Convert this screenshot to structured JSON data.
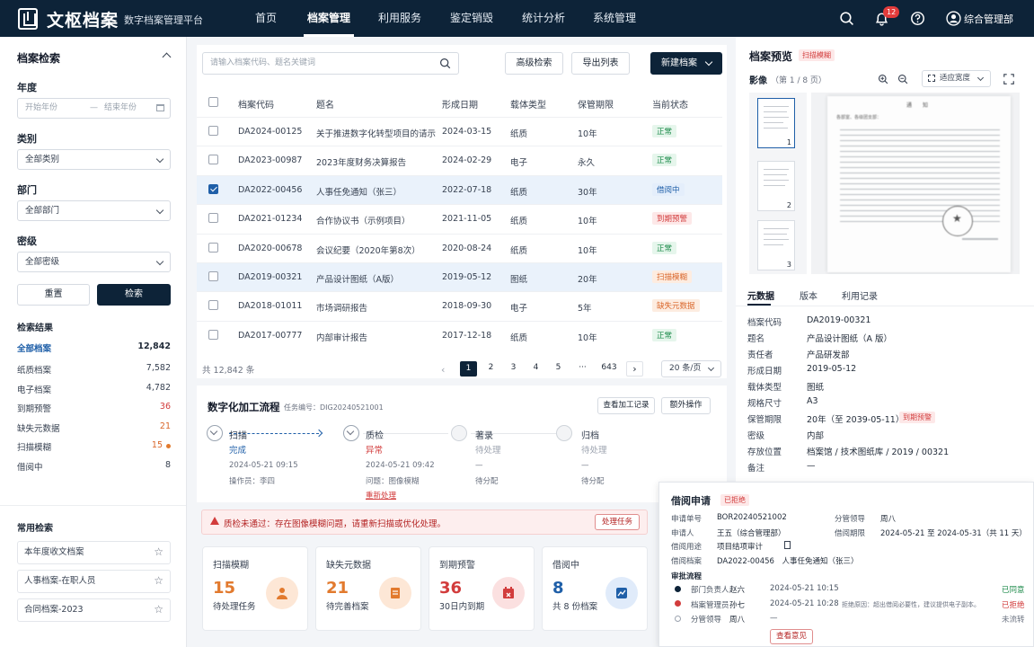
{
  "app": {
    "brand": "文枢档案",
    "subtitle": "数字档案管理平台"
  },
  "nav": [
    "首页",
    "档案管理",
    "利用服务",
    "鉴定销毁",
    "统计分析",
    "系统管理"
  ],
  "header": {
    "notifications": "12",
    "user": "综合管理部"
  },
  "sidebar": {
    "title": "档案检索",
    "year_label": "年度",
    "year_start": "开始年份",
    "year_sep": "—",
    "year_end": "结束年份",
    "category_label": "类别",
    "category_value": "全部类别",
    "dept_label": "部门",
    "dept_value": "全部部门",
    "secret_label": "密级",
    "secret_value": "全部密级",
    "reset": "重置",
    "search": "检索",
    "results_title": "检索结果",
    "results": [
      {
        "label": "全部档案",
        "count": "12,842"
      },
      {
        "label": "纸质档案",
        "count": "7,582"
      },
      {
        "label": "电子档案",
        "count": "4,782"
      },
      {
        "label": "到期预警",
        "count": "36"
      },
      {
        "label": "缺失元数据",
        "count": "21"
      },
      {
        "label": "扫描模糊",
        "count": "15"
      },
      {
        "label": "借阅中",
        "count": "8"
      }
    ],
    "fav_title": "常用检索",
    "favorites": [
      "本年度收文档案",
      "人事档案-在职人员",
      "合同档案-2023"
    ]
  },
  "toolbar": {
    "search_placeholder": "请输入档案代码、题名关键词",
    "advanced": "高级检索",
    "export": "导出列表",
    "new": "新建档案"
  },
  "table": {
    "headers": [
      "档案代码",
      "题名",
      "形成日期",
      "载体类型",
      "保管期限",
      "当前状态"
    ],
    "rows": [
      [
        "DA2024-00125",
        "关于推进数字化转型项目的请示",
        "2024-03-15",
        "纸质",
        "10年",
        "正常"
      ],
      [
        "DA2023-00987",
        "2023年度财务决算报告",
        "2024-02-29",
        "电子",
        "永久",
        "正常"
      ],
      [
        "DA2022-00456",
        "人事任免通知（张三）",
        "2022-07-18",
        "纸质",
        "30年",
        "借阅中"
      ],
      [
        "DA2021-01234",
        "合作协议书（示例项目）",
        "2021-11-05",
        "纸质",
        "10年",
        "到期预警"
      ],
      [
        "DA2020-00678",
        "会议纪要（2020年第8次）",
        "2020-08-24",
        "纸质",
        "10年",
        "正常"
      ],
      [
        "DA2019-00321",
        "产品设计图纸（A版）",
        "2019-05-12",
        "图纸",
        "20年",
        "扫描模糊"
      ],
      [
        "DA2018-01011",
        "市场调研报告",
        "2018-09-30",
        "电子",
        "5年",
        "缺失元数据"
      ],
      [
        "DA2017-00777",
        "内部审计报告",
        "2017-12-18",
        "纸质",
        "10年",
        "正常"
      ]
    ],
    "total": "共 12,842 条",
    "pages": [
      "1",
      "2",
      "3",
      "4",
      "5",
      "···",
      "643"
    ],
    "page_size": "20 条/页"
  },
  "flow": {
    "title": "数字化加工流程",
    "task_no": "任务编号：DIG20240521001",
    "view_log": "查看加工记录",
    "extra": "额外操作",
    "steps": [
      {
        "name": "扫描",
        "status": "完成",
        "time": "2024-05-21 09:15",
        "info": "操作员：李四"
      },
      {
        "name": "质检",
        "status": "异常",
        "time": "2024-05-21 09:42",
        "info": "问题：图像模糊",
        "action": "重新处理"
      },
      {
        "name": "著录",
        "status": "待处理",
        "time": "—",
        "info": "待分配"
      },
      {
        "name": "归档",
        "status": "待处理",
        "time": "—",
        "info": "待分配"
      }
    ]
  },
  "alert": {
    "text": "质检未通过：存在图像模糊问题，请重新扫描或优化处理。",
    "button": "处理任务"
  },
  "cards": [
    {
      "title": "扫描模糊",
      "num": "15",
      "sub": "待处理任务"
    },
    {
      "title": "缺失元数据",
      "num": "21",
      "sub": "待完善档案"
    },
    {
      "title": "到期预警",
      "num": "36",
      "sub": "30日内到期"
    },
    {
      "title": "借阅中",
      "num": "8",
      "sub": "共 8 份档案"
    }
  ],
  "preview": {
    "title": "档案预览",
    "badge": "扫描模糊",
    "image_label": "影像",
    "page_info": "（第 1 / 8 页）",
    "fit": "适应宽度",
    "thumb_nums": [
      "1",
      "2",
      "3"
    ],
    "doc_title": "通　　知",
    "doc_to": "各部室、各级团支部：",
    "tabs": [
      "元数据",
      "版本",
      "利用记录"
    ],
    "meta": [
      {
        "k": "档案代码",
        "v": "DA2019-00321"
      },
      {
        "k": "题名",
        "v": "产品设计图纸（A 版）"
      },
      {
        "k": "责任者",
        "v": "产品研发部"
      },
      {
        "k": "形成日期",
        "v": "2019-05-12"
      },
      {
        "k": "载体类型",
        "v": "图纸"
      },
      {
        "k": "规格尺寸",
        "v": "A3"
      },
      {
        "k": "保管期限",
        "v": "20年（至 2039-05-11）",
        "tag": "到期预警"
      },
      {
        "k": "密级",
        "v": "内部"
      },
      {
        "k": "存放位置",
        "v": "档案馆 / 技术图纸库 / 2019 / 00321"
      },
      {
        "k": "备注",
        "v": "—"
      }
    ]
  },
  "borrow": {
    "title": "借阅申请",
    "badge": "已拒绝",
    "fields": [
      {
        "k": "申请单号",
        "v": "BOR20240521002"
      },
      {
        "k": "申请人",
        "v": "王五（综合管理部）"
      },
      {
        "k": "借阅用途",
        "v": "项目结项审计"
      },
      {
        "k": "借阅档案",
        "v": "DA2022-00456　人事任免通知（张三）"
      }
    ],
    "fields_right": [
      {
        "k": "分管领导",
        "v": "周八"
      },
      {
        "k": "借阅期限",
        "v": "2024-05-21 至 2024-05-31（共 11 天）"
      }
    ],
    "flow_title": "审批流程",
    "approvals": [
      {
        "role": "部门负责人",
        "name": "赵六",
        "time": "2024-05-21 10:15",
        "note": "",
        "result": "已同意"
      },
      {
        "role": "档案管理员",
        "name": "孙七",
        "time": "2024-05-21 10:28",
        "note": "拒绝原因：超出借阅必要性，建议提供电子副本。",
        "result": "已拒绝"
      },
      {
        "role": "分管领导",
        "name": "周八",
        "time": "—",
        "note": "",
        "result": "未流转"
      }
    ],
    "button": "查看意见"
  }
}
